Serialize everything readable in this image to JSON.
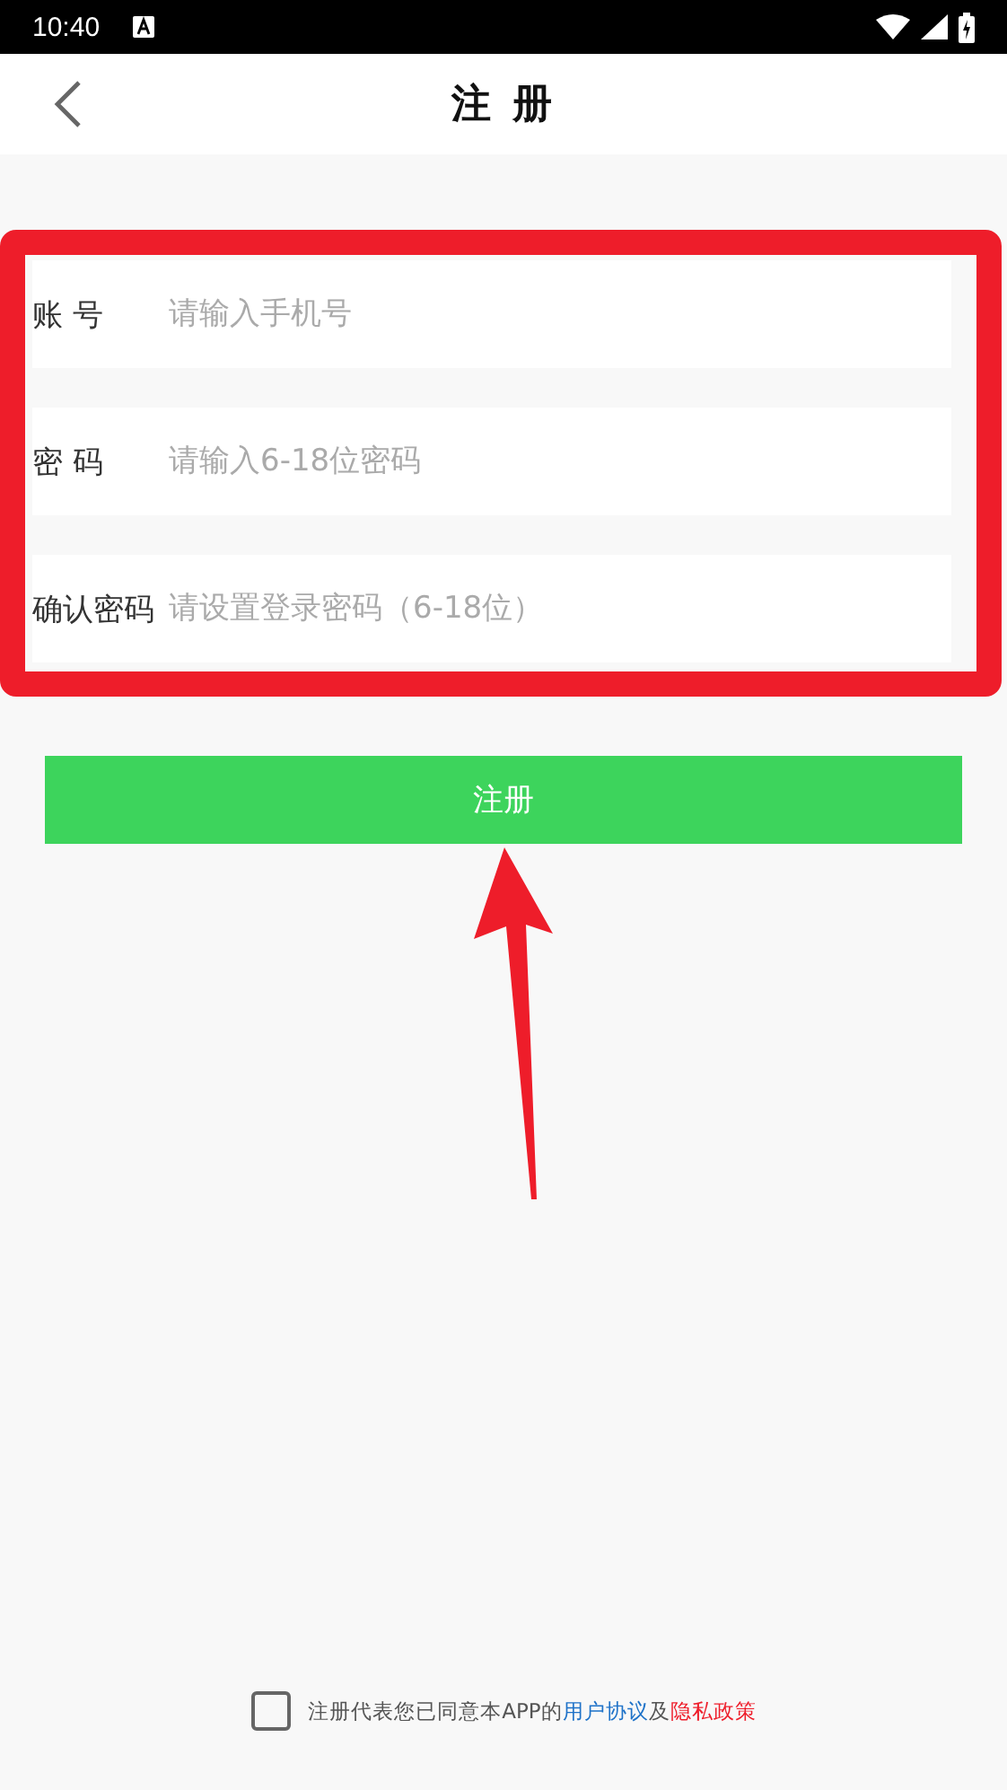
{
  "status_bar": {
    "time": "10:40"
  },
  "header": {
    "title": "注 册"
  },
  "fields": [
    {
      "label": "账 号",
      "placeholder": "请输入手机号"
    },
    {
      "label": "密 码",
      "placeholder": "请输入6-18位密码"
    },
    {
      "label": "确认密码",
      "placeholder": "请设置登录密码（6-18位）"
    }
  ],
  "submit_button": "注册",
  "agreement": {
    "checked": false,
    "text": "注册代表您已同意本APP的",
    "user_agreement": "用户协议",
    "joiner": "及",
    "privacy_policy": "隐私政策"
  }
}
